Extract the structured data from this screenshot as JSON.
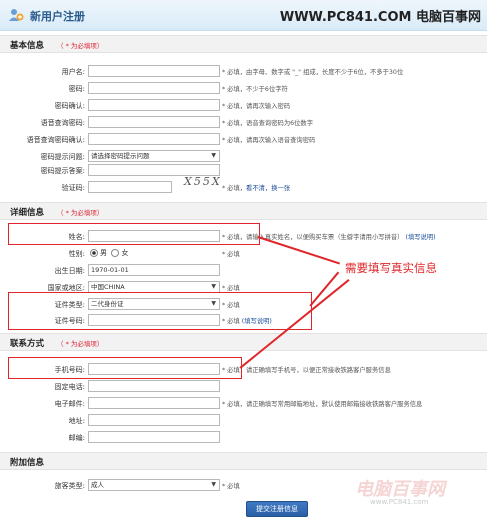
{
  "header": {
    "title": "新用户注册",
    "site_en": "WWW.PC841.COM",
    "site_cn": "电脑百事网"
  },
  "sections": {
    "basic": {
      "title": "基本信息",
      "note": "（ * 为必填项）"
    },
    "detail": {
      "title": "详细信息",
      "note": "（ * 为必填项）"
    },
    "contact": {
      "title": "联系方式",
      "note": "（ * 为必填项）"
    },
    "extra": {
      "title": "附加信息"
    }
  },
  "basic_rows": [
    {
      "label": "用户名:",
      "hint": "* 必填，由字母、数字或 \"_\" 组成，长度不少于6位，不多于30位"
    },
    {
      "label": "密码:",
      "hint": "* 必填，不少于6位字符"
    },
    {
      "label": "密码确认:",
      "hint": "* 必填，请再次输入密码"
    },
    {
      "label": "语音查询密码:",
      "hint": "* 必填，语音查询密码为6位数字"
    },
    {
      "label": "语音查询密码确认:",
      "hint": "* 必填，请再次输入语音查询密码"
    },
    {
      "label": "密码提示问题:",
      "value": "请选择密码提示问题"
    },
    {
      "label": "密码提示答案:"
    },
    {
      "label": "验证码:",
      "captcha": "X55X",
      "hint_prefix": "* 必填，",
      "hint_link": "看不清，换一张"
    }
  ],
  "detail_rows": [
    {
      "label": "姓名:",
      "hint": "* 必填，请输入真实姓名，以便购买车票（生僻字请用小写拼音）",
      "link": "(填写说明)"
    },
    {
      "label": "性别:",
      "male": "男",
      "female": "女",
      "hint": "* 必填"
    },
    {
      "label": "出生日期:",
      "value": "1970-01-01"
    },
    {
      "label": "国家或地区:",
      "value": "中国CHINA",
      "hint": "* 必填"
    },
    {
      "label": "证件类型:",
      "value": "二代身份证",
      "hint": "* 必填"
    },
    {
      "label": "证件号码:",
      "hint": "* 必填",
      "link": "(填写说明)"
    }
  ],
  "contact_rows": [
    {
      "label": "手机号码:",
      "hint": "* 必填，请正确填写手机号，以便正常接收铁路客户服务信息"
    },
    {
      "label": "固定电话:"
    },
    {
      "label": "电子邮件:",
      "hint": "* 必填，请正确填写常用邮箱地址，默认使用邮箱接收铁路客户服务信息"
    },
    {
      "label": "地址:"
    },
    {
      "label": "邮编:"
    }
  ],
  "extra_rows": [
    {
      "label": "旅客类型:",
      "value": "成人",
      "hint": "* 必填"
    }
  ],
  "callout": "需要填写真实信息",
  "submit_label": "提交注册信息",
  "watermark": "电脑百事网",
  "watermark_small": "www.PC841.com",
  "colors": {
    "annotation": "#e0262a",
    "header_title": "#2a5a8c",
    "link": "#1a4d9a"
  }
}
